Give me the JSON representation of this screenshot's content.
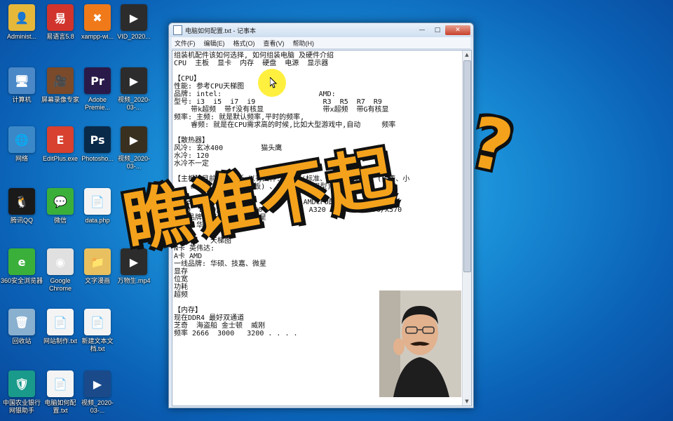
{
  "desktop": {
    "icons": [
      {
        "label": "Administ...",
        "color": "#e6b83a",
        "glyph": "👤"
      },
      {
        "label": "易语言5.8",
        "color": "#d0342c",
        "glyph": "易"
      },
      {
        "label": "xampp-wi...",
        "color": "#f07a1a",
        "glyph": "✖"
      },
      {
        "label": "VID_2020...",
        "color": "#2c2c2c",
        "glyph": "▶"
      },
      {
        "label": "计算机",
        "color": "#4a88c8",
        "glyph": "🖥"
      },
      {
        "label": "屏幕录像专家",
        "color": "#7a4a2a",
        "glyph": "🎥"
      },
      {
        "label": "Adobe Premie...",
        "color": "#2a1a4a",
        "glyph": "Pr"
      },
      {
        "label": "视频_2020-03-...",
        "color": "#2c2c2c",
        "glyph": "▶"
      },
      {
        "label": "网络",
        "color": "#3a88c8",
        "glyph": "🌐"
      },
      {
        "label": "EditPlus.exe",
        "color": "#d84030",
        "glyph": "E"
      },
      {
        "label": "Photosho...",
        "color": "#0a2a4a",
        "glyph": "Ps"
      },
      {
        "label": "视频_2020-03-...",
        "color": "#3a3020",
        "glyph": "▶"
      },
      {
        "label": "腾讯QQ",
        "color": "#1a1a1a",
        "glyph": "🐧"
      },
      {
        "label": "微信",
        "color": "#3ab03a",
        "glyph": "💬"
      },
      {
        "label": "data.php",
        "color": "#f4f4f4",
        "glyph": "📄"
      },
      {
        "label": "360安全浏览器",
        "color": "#3ab03a",
        "glyph": "e"
      },
      {
        "label": "Google Chrome",
        "color": "#e0e0e0",
        "glyph": "◉"
      },
      {
        "label": "文字漫画",
        "color": "#e8c060",
        "glyph": "📁"
      },
      {
        "label": "万物生.mp4",
        "color": "#2c2c2c",
        "glyph": "▶"
      },
      {
        "label": "回收站",
        "color": "#8ab0d0",
        "glyph": "🗑"
      },
      {
        "label": "网站制作.txt",
        "color": "#f4f4f4",
        "glyph": "📄"
      },
      {
        "label": "新建文本文档.txt",
        "color": "#f4f4f4",
        "glyph": "📄"
      },
      {
        "label": "中国农业银行网银助手",
        "color": "#1a9a8a",
        "glyph": "🛡"
      },
      {
        "label": "电脑如何配置.txt",
        "color": "#f4f4f4",
        "glyph": "📄"
      },
      {
        "label": "视频_2020-03-...",
        "color": "#1a4a8a",
        "glyph": "▶"
      }
    ]
  },
  "notepad": {
    "title": "电脑如何配置.txt - 记事本",
    "min_label": "—",
    "max_label": "□",
    "close_label": "✕",
    "menu": [
      "文件(F)",
      "编辑(E)",
      "格式(O)",
      "查看(V)",
      "帮助(H)"
    ],
    "content": "组装机配件该如何选择, 如何组装电脑 及硬件介绍\nCPU  主板  显卡  内存  硬盘  电源  显示器\n\n【CPU】\n性能: 参考CPU天梯图\n品牌: intel:                       AMD:\n型号: i3  i5  i7  i9                R3  R5  R7  R9\n    带k超频  带f没有核显              带x超频  带G有核显\n频率: 主频: 就是默认频率,平时的频率,\n    睿频: 就是在CPU需求高的时候,比如大型游戏中,自动     频率\n\n【散热器】\n风冷: 玄冰400         猫头鹰\n水冷: 120\n水冷不一定\n\n【主板】目前主流主板 以有四种: ATX (标准、大板) 、MATX (紧凑、小\n    mini-ITX (迷你主板) 、E-ATX (加强型)\n\nIntelCPU配:                    AMDCPU配:\nH310  B360/B365  Z390           A320   B450  X470/X570\n一线品牌: 华硕、技嘉、微星\n二线: 华擎 七彩虹. . .\n\n【显卡】  天梯图\nN卡 英伟达:\nA卡 AMD\n一线品牌: 华硕、技嘉、微星\n显存\n位宽\n功耗\n超频\n\n【内存】\n现在DDR4 最好双通道\n芝奇  海盗船 金士顿  威刚\n频率 2666  3000   3200 . . . ."
  },
  "overlay": {
    "main_text": "瞧谁不起",
    "question_mark": "?",
    "color": "#f4a21c"
  }
}
